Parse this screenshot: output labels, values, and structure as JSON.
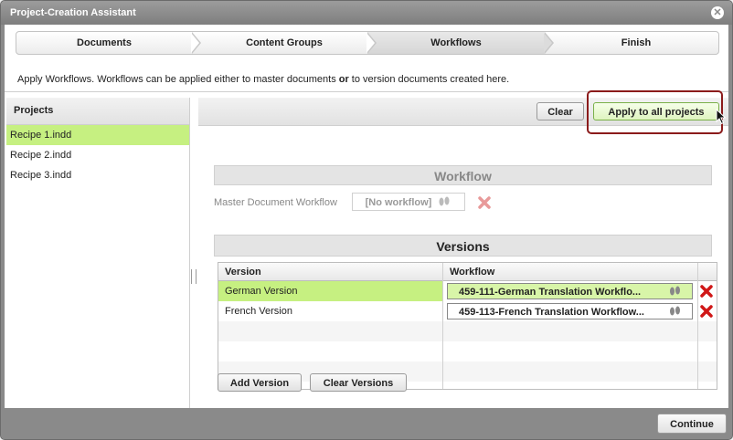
{
  "window": {
    "title": "Project-Creation Assistant"
  },
  "steps": [
    {
      "label": "Documents"
    },
    {
      "label": "Content Groups"
    },
    {
      "label": "Workflows"
    },
    {
      "label": "Finish"
    }
  ],
  "intro": {
    "before": "Apply Workflows. Workflows can be applied either to master documents ",
    "bold": "or",
    "after": " to version documents created here."
  },
  "projects": {
    "header": "Projects",
    "items": [
      {
        "label": "Recipe 1.indd",
        "selected": true
      },
      {
        "label": "Recipe 2.indd"
      },
      {
        "label": "Recipe 3.indd"
      }
    ]
  },
  "toolbar": {
    "clear_label": "Clear",
    "apply_label": "Apply to all projects"
  },
  "workflow_section": {
    "title": "Workflow",
    "master_label": "Master Document Workflow",
    "master_value": "[No workflow]"
  },
  "versions": {
    "title": "Versions",
    "col_version": "Version",
    "col_workflow": "Workflow",
    "rows": [
      {
        "version": "German Version",
        "workflow": "459-111-German Translation Workflo...",
        "selected": true
      },
      {
        "version": "French Version",
        "workflow": "459-113-French Translation Workflow..."
      }
    ],
    "add_label": "Add Version",
    "clear_label": "Clear Versions"
  },
  "footer": {
    "continue_label": "Continue"
  },
  "colors": {
    "selection": "#c6f081",
    "highlight": "#8b1b1b",
    "delete_red": "#d01818"
  }
}
